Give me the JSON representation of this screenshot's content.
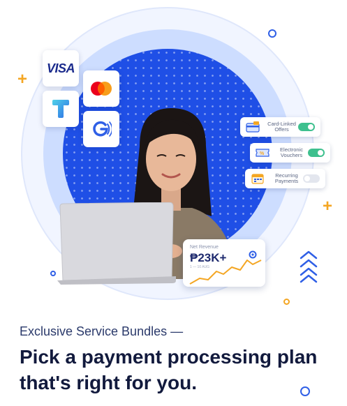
{
  "hero": {
    "logos": [
      {
        "name": "visa",
        "text": "VISA"
      },
      {
        "name": "mastercard"
      },
      {
        "name": "t-logo"
      },
      {
        "name": "g-logo"
      }
    ],
    "toggles": [
      {
        "label": "Card-Linked Offers",
        "state": "on"
      },
      {
        "label": "Electronic Vouchers",
        "state": "on"
      },
      {
        "label": "Recurring Payments",
        "state": "off"
      }
    ],
    "revenue_card": {
      "title": "Net Revenue",
      "value": "₱23K+",
      "subtitle": "1 — 10 AUG"
    },
    "colors": {
      "brand_blue": "#1f4fe6",
      "accent_orange": "#f4a623",
      "toggle_green": "#3ec08e",
      "dark_text": "#121a3d"
    }
  },
  "content": {
    "subtitle": "Exclusive Service Bundles —",
    "headline": "Pick a payment processing plan that's right for you."
  }
}
